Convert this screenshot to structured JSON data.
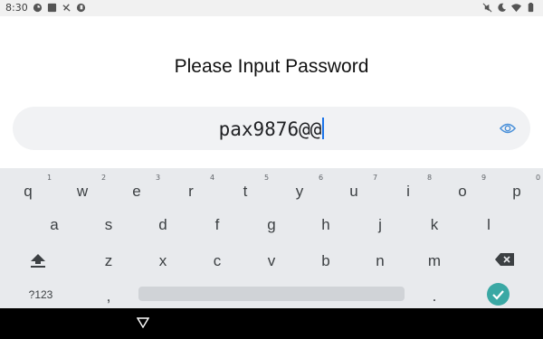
{
  "status_bar": {
    "time": "8:30",
    "left_icons": [
      "app-icon",
      "square-icon",
      "wifi-off-icon",
      "app-icon-2"
    ],
    "right_icons": [
      "mute-icon",
      "dnd-moon-icon",
      "wifi-icon",
      "battery-icon"
    ]
  },
  "screen": {
    "title": "Please Input Password",
    "password_value": "pax9876@@",
    "visibility_icon": "eye-icon"
  },
  "keyboard": {
    "row1": [
      "q",
      "w",
      "e",
      "r",
      "t",
      "y",
      "u",
      "i",
      "o",
      "p"
    ],
    "row1_hints": [
      "1",
      "2",
      "3",
      "4",
      "5",
      "6",
      "7",
      "8",
      "9",
      "0"
    ],
    "row2": [
      "a",
      "s",
      "d",
      "f",
      "g",
      "h",
      "j",
      "k",
      "l"
    ],
    "row3": [
      "z",
      "x",
      "c",
      "v",
      "b",
      "n",
      "m"
    ],
    "symbols_key": "?123",
    "comma_key": ",",
    "period_key": ".",
    "shift_icon": "shift-icon",
    "backspace_icon": "backspace-icon",
    "enter_icon": "check-icon",
    "accent": "#3aa8a4"
  },
  "nav_bar": {
    "back_icon": "back-triangle-icon"
  }
}
